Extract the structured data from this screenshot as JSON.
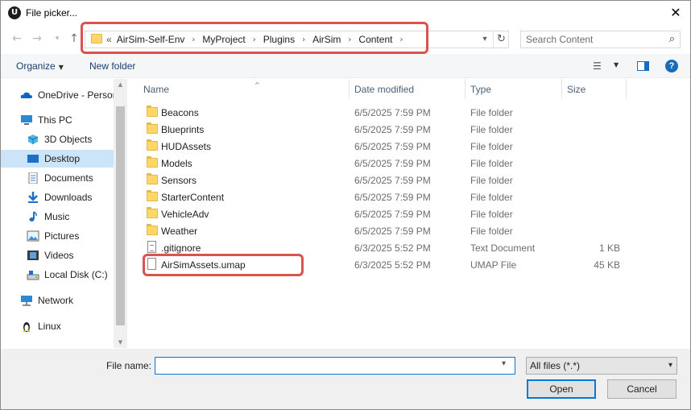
{
  "window": {
    "title": "File picker...",
    "app_icon": "unreal-engine-logo",
    "close_icon": "close-icon"
  },
  "nav": {
    "back_icon": "back-arrow-icon",
    "forward_icon": "forward-arrow-icon",
    "recent_icon": "chevron-down-icon",
    "up_icon": "up-arrow-icon"
  },
  "address": {
    "overflow": "«",
    "crumbs": [
      "AirSim-Self-Env",
      "MyProject",
      "Plugins",
      "AirSim",
      "Content"
    ]
  },
  "search": {
    "placeholder": "Search Content"
  },
  "toolbar": {
    "organize": "Organize",
    "new_folder": "New folder"
  },
  "sidebar": {
    "items": [
      {
        "label": "OneDrive - Personal",
        "icon": "onedrive-cloud-icon"
      },
      {
        "label": "This PC",
        "icon": "computer-icon"
      },
      {
        "label": "3D Objects",
        "icon": "3d-objects-icon"
      },
      {
        "label": "Desktop",
        "icon": "desktop-icon",
        "selected": true
      },
      {
        "label": "Documents",
        "icon": "documents-icon"
      },
      {
        "label": "Downloads",
        "icon": "downloads-icon"
      },
      {
        "label": "Music",
        "icon": "music-icon"
      },
      {
        "label": "Pictures",
        "icon": "pictures-icon"
      },
      {
        "label": "Videos",
        "icon": "videos-icon"
      },
      {
        "label": "Local Disk (C:)",
        "icon": "drive-icon"
      },
      {
        "label": "Network",
        "icon": "network-icon"
      },
      {
        "label": "Linux",
        "icon": "linux-icon"
      }
    ]
  },
  "columns": {
    "name": "Name",
    "date": "Date modified",
    "type": "Type",
    "size": "Size"
  },
  "files": [
    {
      "name": "Beacons",
      "date": "6/5/2025 7:59 PM",
      "type": "File folder",
      "size": "",
      "icon": "folder-icon"
    },
    {
      "name": "Blueprints",
      "date": "6/5/2025 7:59 PM",
      "type": "File folder",
      "size": "",
      "icon": "folder-icon"
    },
    {
      "name": "HUDAssets",
      "date": "6/5/2025 7:59 PM",
      "type": "File folder",
      "size": "",
      "icon": "folder-icon"
    },
    {
      "name": "Models",
      "date": "6/5/2025 7:59 PM",
      "type": "File folder",
      "size": "",
      "icon": "folder-icon"
    },
    {
      "name": "Sensors",
      "date": "6/5/2025 7:59 PM",
      "type": "File folder",
      "size": "",
      "icon": "folder-icon"
    },
    {
      "name": "StarterContent",
      "date": "6/5/2025 7:59 PM",
      "type": "File folder",
      "size": "",
      "icon": "folder-icon"
    },
    {
      "name": "VehicleAdv",
      "date": "6/5/2025 7:59 PM",
      "type": "File folder",
      "size": "",
      "icon": "folder-icon"
    },
    {
      "name": "Weather",
      "date": "6/5/2025 7:59 PM",
      "type": "File folder",
      "size": "",
      "icon": "folder-icon"
    },
    {
      "name": ".gitignore",
      "date": "6/3/2025 5:52 PM",
      "type": "Text Document",
      "size": "1 KB",
      "icon": "text-document-icon"
    },
    {
      "name": "AirSimAssets.umap",
      "date": "6/3/2025 5:52 PM",
      "type": "UMAP File",
      "size": "45 KB",
      "icon": "file-icon"
    }
  ],
  "bottom": {
    "filename_label": "File name:",
    "filename_value": "",
    "filter_selected": "All files (*.*)",
    "open_label": "Open",
    "cancel_label": "Cancel"
  },
  "colors": {
    "highlight": "#d9534f",
    "accent": "#0078d7",
    "selected_bg": "#cce4f7"
  }
}
